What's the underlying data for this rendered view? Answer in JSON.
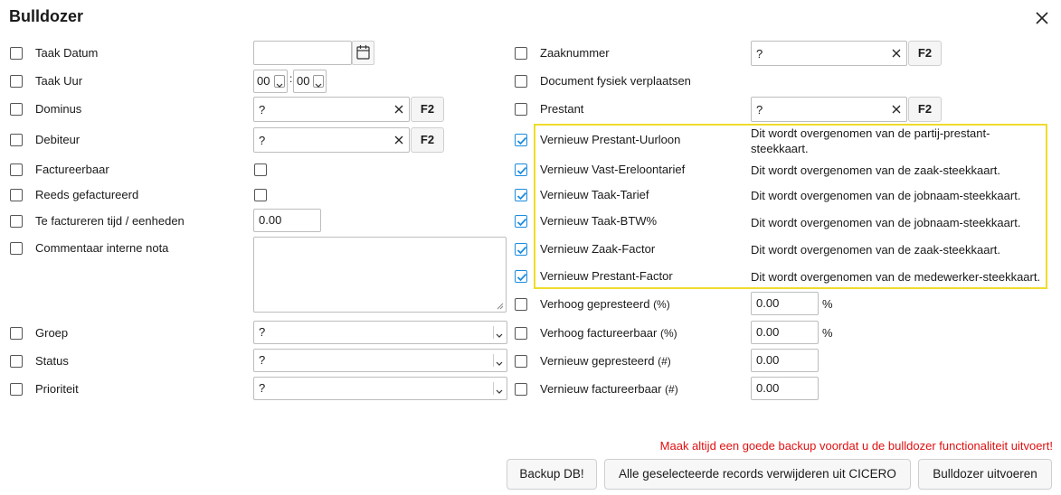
{
  "dialog": {
    "title": "Bulldozer"
  },
  "left": {
    "taak_datum": {
      "label": "Taak Datum",
      "value": ""
    },
    "taak_uur": {
      "label": "Taak Uur",
      "hour": "00",
      "minute": "00",
      "separator": ":"
    },
    "dominus": {
      "label": "Dominus",
      "value": "?",
      "f2": "F2"
    },
    "debiteur": {
      "label": "Debiteur",
      "value": "?",
      "f2": "F2"
    },
    "factureerbaar": {
      "label": "Factureerbaar"
    },
    "reeds_gefactureerd": {
      "label": "Reeds gefactureerd"
    },
    "te_factureren": {
      "label": "Te factureren tijd / eenheden",
      "value": "0.00"
    },
    "commentaar": {
      "label": "Commentaar interne nota",
      "value": ""
    },
    "groep": {
      "label": "Groep",
      "value": "?"
    },
    "status": {
      "label": "Status",
      "value": "?"
    },
    "prioriteit": {
      "label": "Prioriteit",
      "value": "?"
    }
  },
  "right": {
    "zaaknummer": {
      "label": "Zaaknummer",
      "value": "?",
      "f2": "F2"
    },
    "document_fysiek": {
      "label": "Document fysiek verplaatsen"
    },
    "prestant": {
      "label": "Prestant",
      "value": "?",
      "f2": "F2"
    },
    "vernieuw": [
      {
        "label": "Vernieuw Prestant-Uurloon",
        "note": "Dit wordt overgenomen van de partij-prestant-steekkaart.",
        "note_line1": "Dit wordt overgenomen van de partij-prestant-",
        "note_line2": "steekkaart.",
        "checked": true
      },
      {
        "label": "Vernieuw Vast-Ereloontarief",
        "note": "Dit wordt overgenomen van de zaak-steekkaart.",
        "checked": true
      },
      {
        "label": "Vernieuw Taak-Tarief",
        "note": "Dit wordt overgenomen van de jobnaam-steekkaart.",
        "checked": true
      },
      {
        "label": "Vernieuw Taak-BTW%",
        "note": "Dit wordt overgenomen van de jobnaam-steekkaart.",
        "checked": true
      },
      {
        "label": "Vernieuw Zaak-Factor",
        "note": "Dit wordt overgenomen van de zaak-steekkaart.",
        "checked": true
      },
      {
        "label": "Vernieuw Prestant-Factor",
        "note": "Dit wordt overgenomen van de medewerker-steekkaart.",
        "checked": true
      }
    ],
    "verhoog_gepresteerd": {
      "label": "Verhoog gepresteerd",
      "suffix": "(%)",
      "value": "0.00",
      "unit": "%"
    },
    "verhoog_factureerbaar": {
      "label": "Verhoog factureerbaar",
      "suffix": "(%)",
      "value": "0.00",
      "unit": "%"
    },
    "vernieuw_gepresteerd": {
      "label": "Vernieuw gepresteerd",
      "suffix": "(#)",
      "value": "0.00"
    },
    "vernieuw_factureerbaar": {
      "label": "Vernieuw factureerbaar",
      "suffix": "(#)",
      "value": "0.00"
    }
  },
  "footer": {
    "warning": "Maak altijd een goede backup voordat u de bulldozer functionaliteit uitvoert!",
    "backup_button": "Backup DB!",
    "delete_button": "Alle geselecteerde records verwijderen uit CICERO",
    "execute_button": "Bulldozer uitvoeren"
  },
  "colors": {
    "highlight": "#f0dc2c",
    "check": "#1b8ce0",
    "warning": "#e01010"
  }
}
